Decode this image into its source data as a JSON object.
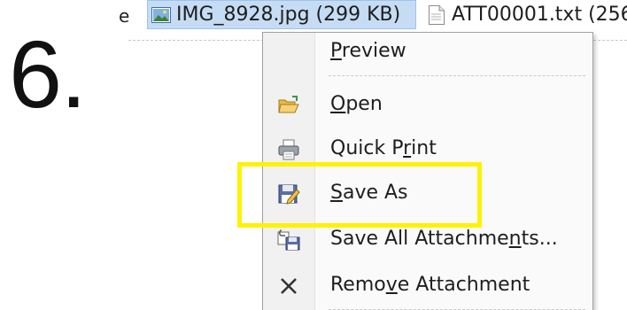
{
  "step": {
    "number": "6."
  },
  "attachments": {
    "edge_text": "e",
    "items": [
      {
        "icon": "image-file-icon",
        "label": "IMG_8928.jpg (299 KB)",
        "selected": true
      },
      {
        "icon": "text-file-icon",
        "label": "ATT00001.txt (256",
        "selected": false
      }
    ]
  },
  "context_menu": {
    "items": [
      {
        "label": "Preview",
        "access_key": "P",
        "icon": null
      },
      {
        "label": "Open",
        "access_key": "O",
        "icon": "open-folder-icon"
      },
      {
        "label": "Quick Print",
        "access_key": "r",
        "icon": "printer-icon"
      },
      {
        "label": "Save As",
        "access_key": "S",
        "icon": "save-as-icon",
        "highlighted": true
      },
      {
        "label": "Save All Attachments...",
        "access_key": "n",
        "icon": "save-all-attachments-icon"
      },
      {
        "label": "Remove Attachment",
        "access_key": "v",
        "icon": "remove-x-icon"
      }
    ]
  },
  "colors": {
    "highlight": "#fff200",
    "selection": "#c5dcf4"
  }
}
